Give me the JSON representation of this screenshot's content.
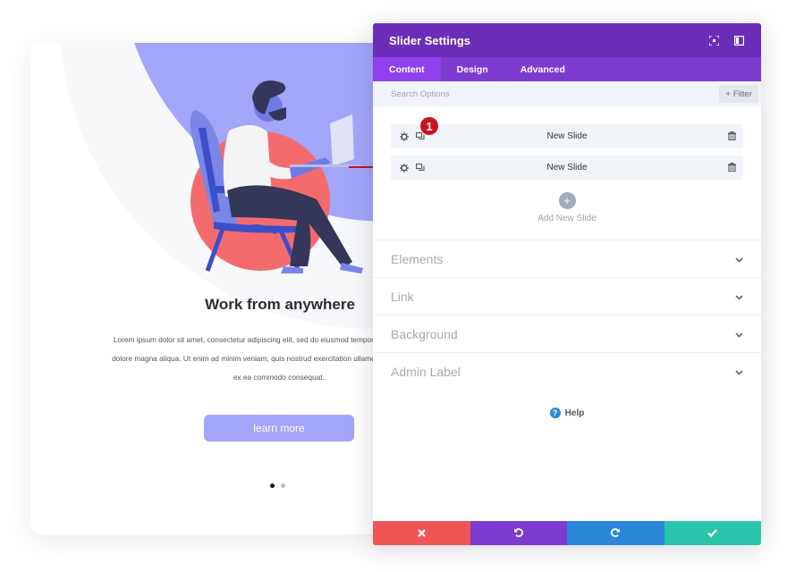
{
  "preview": {
    "title": "Work from anywhere",
    "body_lines": [
      "Lorem ipsum dolor sit amet, consectetur adipiscing elit, sed do eiusmod tempor incididunt ut labore et",
      "dolore magna aliqua. Ut enim ad minim veniam, quis nostrud exercitation ullamco laboris nisi ut aliquip",
      "ex ea commodo consequat.."
    ],
    "button_label": "learn more",
    "dots": {
      "count": 2,
      "active_index": 0
    },
    "colors": {
      "accent": "#a3a5f9",
      "circle": "#f46b6e"
    }
  },
  "panel": {
    "title": "Slider Settings",
    "header_icons": [
      "expand-icon",
      "sidebar-toggle-icon"
    ],
    "tabs": [
      {
        "label": "Content",
        "active": true
      },
      {
        "label": "Design",
        "active": false
      },
      {
        "label": "Advanced",
        "active": false
      }
    ],
    "search": {
      "placeholder": "Search Options",
      "value": ""
    },
    "filter_label": "Filter",
    "slides": [
      {
        "label": "New Slide"
      },
      {
        "label": "New Slide"
      }
    ],
    "annotation_badge": "1",
    "add_slide_label": "Add New Slide",
    "sections": [
      {
        "label": "Elements"
      },
      {
        "label": "Link"
      },
      {
        "label": "Background"
      },
      {
        "label": "Admin Label"
      }
    ],
    "help_label": "Help",
    "footer": {
      "cancel_icon": "close-icon",
      "undo_icon": "undo-icon",
      "redo_icon": "redo-icon",
      "save_icon": "check-icon"
    },
    "colors": {
      "header": "#6c2eb9",
      "tabs": "#7e3bd0",
      "cancel": "#ef5555",
      "undo": "#7d3bcf",
      "redo": "#2b87da",
      "save": "#29c4a9",
      "badge": "#c7141f"
    }
  }
}
